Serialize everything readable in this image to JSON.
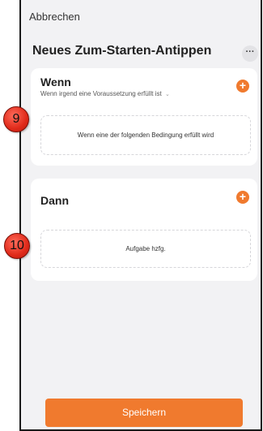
{
  "header": {
    "cancel_label": "Abbrechen",
    "title": "Neues Zum-Starten-Antippen",
    "more_label": "···"
  },
  "if_card": {
    "title": "Wenn",
    "subtitle": "Wenn irgend eine Voraussetzung erfüllt ist",
    "subtitle_caret": "⌄",
    "add_label": "+",
    "dropzone_text": "Wenn eine der folgenden Bedingung erfüllt wird"
  },
  "then_card": {
    "title": "Dann",
    "add_label": "+",
    "dropzone_text": "Aufgabe hzfg."
  },
  "footer": {
    "save_label": "Speichern"
  },
  "annotations": {
    "marker_9": "9",
    "marker_10": "10"
  },
  "colors": {
    "accent": "#f07a2e",
    "background": "#f2f2f4",
    "card": "#ffffff",
    "marker": "#e02a1a"
  }
}
